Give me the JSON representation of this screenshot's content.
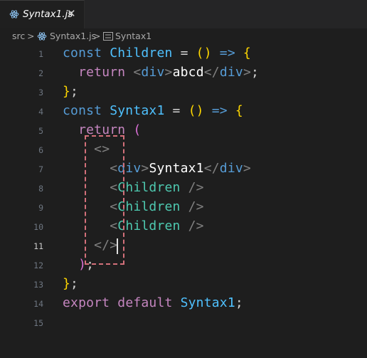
{
  "tab": {
    "label": "Syntax1.js",
    "close": "✕",
    "icon": "react-icon"
  },
  "breadcrumb": {
    "folder": "src",
    "sep1": ">",
    "file": "Syntax1.js",
    "sep2": ">",
    "symbol": "Syntax1",
    "file_icon": "react-icon",
    "symbol_icon": "symbol-variable-icon"
  },
  "active_line": 11,
  "lines": [
    {
      "n": "1"
    },
    {
      "n": "2"
    },
    {
      "n": "3"
    },
    {
      "n": "4"
    },
    {
      "n": "5"
    },
    {
      "n": "6"
    },
    {
      "n": "7"
    },
    {
      "n": "8"
    },
    {
      "n": "9"
    },
    {
      "n": "10"
    },
    {
      "n": "11"
    },
    {
      "n": "12"
    },
    {
      "n": "13"
    },
    {
      "n": "14"
    },
    {
      "n": "15"
    }
  ],
  "tokens": {
    "const": "const",
    "children_name": "Children",
    "eq": "=",
    "parens": "()",
    "arrow": "=>",
    "brace_open": "{",
    "brace_close": "}",
    "semi": ";",
    "return": "return",
    "div_open": "<div>",
    "abcd": "abcd",
    "div_close": "</div>",
    "syntax1_name": "Syntax1",
    "paren_open": "(",
    "paren_close": ")",
    "frag_open": "<>",
    "syntax1_text": "Syntax1",
    "child_tag": "<Children />",
    "frag_close": "</>",
    "export": "export",
    "default": "default",
    "syntax1_export": "Syntax1"
  }
}
